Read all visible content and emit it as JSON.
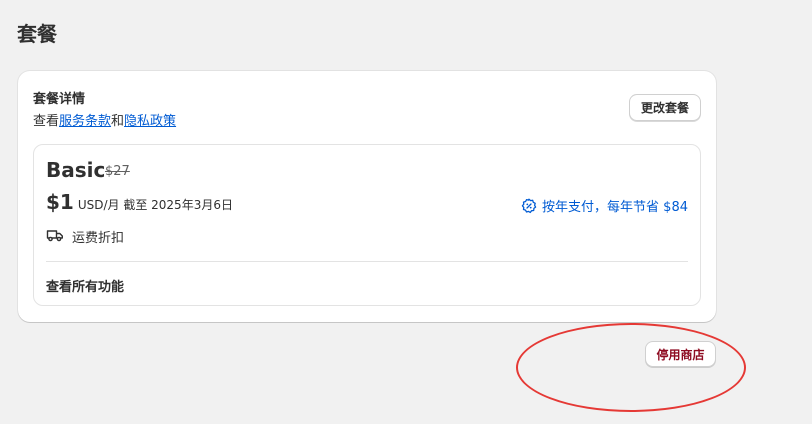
{
  "page": {
    "title": "套餐"
  },
  "plan_card": {
    "title": "套餐详情",
    "subtitle_prefix": "查看",
    "terms_link": "服务条款",
    "subtitle_and": "和",
    "privacy_link": "隐私政策",
    "change_button": "更改套餐"
  },
  "plan": {
    "name": "Basic",
    "original_price": "$27",
    "price": "$1",
    "price_unit": "USD/月 截至 2025年3月6日",
    "annual_offer": "按年支付，每年节省 $84",
    "annual_offer_icon": "discount-badge-icon",
    "features": [
      {
        "icon": "truck-icon",
        "label": "运费折扣"
      }
    ],
    "all_features_link": "查看所有功能"
  },
  "actions": {
    "deactivate_button": "停用商店"
  },
  "colors": {
    "link": "#005bd3",
    "danger": "#8e0b21",
    "annotation": "#e53935",
    "background": "#f1f1f1"
  }
}
